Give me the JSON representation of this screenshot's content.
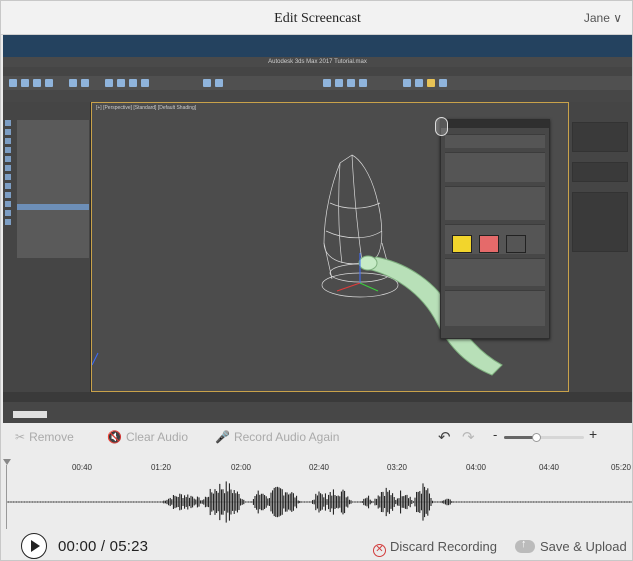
{
  "window": {
    "title": "Edit Screencast",
    "user": "Jane ∨"
  },
  "recording": {
    "app_title": "Autodesk 3ds Max 2017   Tutorial.max",
    "viewport_label": "[+] [Perspective] [Standard] [Default Shading]"
  },
  "toolbar": {
    "remove": "Remove",
    "clear_audio": "Clear Audio",
    "record_again": "Record Audio Again"
  },
  "zoom": {
    "minus": "-",
    "plus": "+",
    "level_fraction": 0.4
  },
  "timeline": {
    "ticks": [
      "00:40",
      "01:20",
      "02:00",
      "02:40",
      "03:20",
      "04:00",
      "04:40",
      "05:20"
    ],
    "wave_color": "#111111"
  },
  "player": {
    "current_time": "00:00",
    "separator": "/",
    "duration": "05:23"
  },
  "actions": {
    "discard": "Discard Recording",
    "save": "Save & Upload"
  },
  "colors": {
    "video_background": "#24425f",
    "discard_accent": "#d23c3c",
    "swatch_yellow": "#f2d52c",
    "swatch_red": "#e56a6a",
    "swatch_gray": "#555555"
  }
}
